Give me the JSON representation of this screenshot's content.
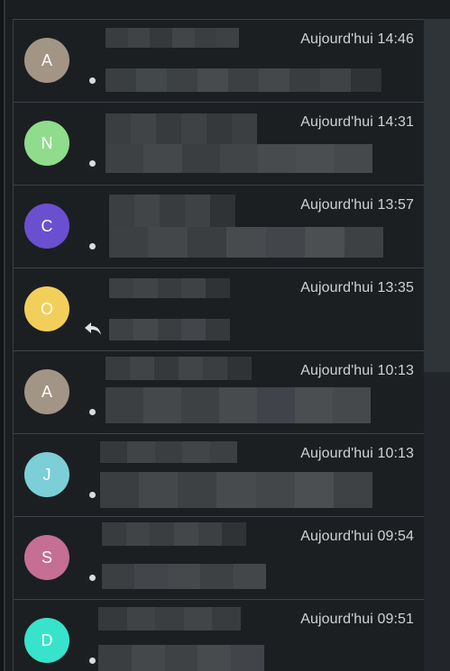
{
  "messages": [
    {
      "initial": "A",
      "avatar_color": "#a39585",
      "time": "Aujourd'hui 14:46",
      "marker": "dot"
    },
    {
      "initial": "N",
      "avatar_color": "#8fdc8c",
      "time": "Aujourd'hui 14:31",
      "marker": "dot"
    },
    {
      "initial": "C",
      "avatar_color": "#6a4fd0",
      "time": "Aujourd'hui 13:57",
      "marker": "dot"
    },
    {
      "initial": "O",
      "avatar_color": "#f2cf5a",
      "time": "Aujourd'hui 13:35",
      "marker": "reply-icon"
    },
    {
      "initial": "A",
      "avatar_color": "#a39585",
      "time": "Aujourd'hui 10:13",
      "marker": "dot"
    },
    {
      "initial": "J",
      "avatar_color": "#7ccfd6",
      "time": "Aujourd'hui 10:13",
      "marker": "dot"
    },
    {
      "initial": "S",
      "avatar_color": "#c46f93",
      "time": "Aujourd'hui 09:54",
      "marker": "dot"
    },
    {
      "initial": "D",
      "avatar_color": "#38e3cc",
      "time": "Aujourd'hui 09:51",
      "marker": "dot"
    }
  ]
}
